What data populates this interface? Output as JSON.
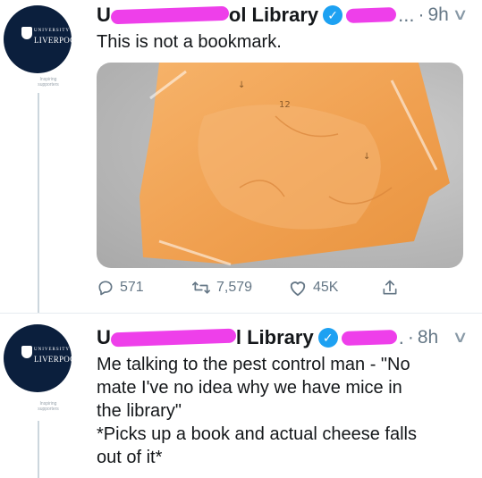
{
  "tweet1": {
    "author_name_start": "U",
    "author_name_end": "ol Library",
    "handle_tail": "...",
    "separator": "·",
    "time": "9h",
    "text": "This is not a bookmark.",
    "stats": {
      "replies": "571",
      "retweets": "7,579",
      "likes": "45K"
    }
  },
  "tweet2": {
    "author_name_start": "U",
    "author_name_end": "l Library",
    "handle_tail": ".",
    "separator": "·",
    "time": "8h",
    "text_lines": [
      "Me talking to the pest control man - \"No",
      "mate I've no idea why we have mice in",
      "the library\"",
      "*Picks up a book and actual cheese falls",
      "out of it*"
    ]
  },
  "avatar": {
    "logo_small": "UNIVERSITY OF",
    "logo_main": "LIVERPOOL",
    "caption": "Inspiring supporters"
  },
  "icons": {
    "verified": "verified-badge-icon",
    "menu": "chevron-down-icon",
    "reply": "reply-icon",
    "retweet": "retweet-icon",
    "like": "heart-icon",
    "share": "share-icon"
  },
  "colors": {
    "verified": "#1da1f2",
    "redaction": "#ee3fea",
    "avatar_bg": "#0b1f3d",
    "cheese": "#f0a050",
    "meta_gray": "#657786"
  }
}
